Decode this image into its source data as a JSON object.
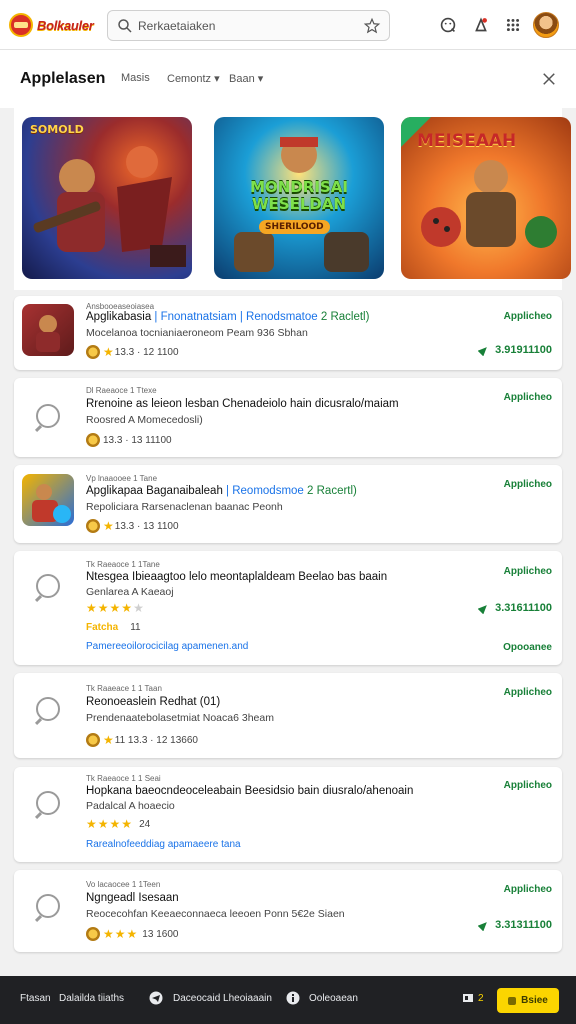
{
  "topbar": {
    "logo_text": "Bolkauler",
    "search_text": "Rerkaetaiaken",
    "icons": [
      "search-icon",
      "star-icon",
      "smiley-icon",
      "notification-icon",
      "apps-grid-icon",
      "avatar"
    ]
  },
  "header": {
    "title": "Applelasen",
    "filters": [
      "Masis",
      "Cemontz",
      "Baan"
    ]
  },
  "banners": [
    {
      "label": "SOMOLD",
      "colors": [
        "#2c3e91",
        "#e25822"
      ]
    },
    {
      "label": "MONDRISAI WESELDAN",
      "sublabel": "SHERILOOD",
      "colors": [
        "#1b9ed6",
        "#f5a623"
      ]
    },
    {
      "label": "MEISEAAH",
      "colors": [
        "#f39c12",
        "#e74c3c"
      ]
    }
  ],
  "cards": [
    {
      "meta": "Ansbooeaseoiasea",
      "title": "Apglikabasia",
      "title_blue": "| Fnonatnatsiam | Renodsmatoe",
      "title_green": "2 Racletl)",
      "sub": "Mocelanoa tocnianiaeroneom Peam 936 Sbhan",
      "rating": "13.3 · 12 1100",
      "badge": "Applicheo",
      "price": "3.91911100"
    },
    {
      "meta": "Dl Raeaoce 1 Ttexe",
      "title": "Rrenoine as leieon lesban Chenadeiolo hain dicusralo/maiam",
      "sub": "Roosred A Momecedosli)",
      "rating": "13.3 · 13 11100",
      "badge": "Applicheo"
    },
    {
      "meta": "Vp lnaaooee 1 Tane",
      "title": "Apglikapaa Baganaibaleah",
      "title_blue": "| Reomodsmoe",
      "title_green": "2 Racertl)",
      "sub": "Repoliciara Rarsenaclenan baanac Peonh",
      "rating": "13.3 · 13 1100",
      "badge": "Applicheo"
    },
    {
      "meta": "Tk Raeaoce 1 1Tane",
      "title": "Ntesgea Ibieaagtoo lelo meontaplaldeam Beelao bas baain",
      "sub": "Genlarea A Kaeaoj",
      "stars": 4,
      "rating_label": "Fatcha",
      "count": "11",
      "link": "Pamereeoilorocicilag apamenen.and",
      "badge": "Applicheo",
      "price": "3.31611100",
      "secondary": "Opooanee"
    },
    {
      "meta": "Tk Raaeace 1 1 Taan",
      "title": "Reonoeaslein Redhat (01)",
      "sub": "Prendenaatebolasetmiat Noaca6 3heam",
      "rating": "11 13.3 · 12 13660",
      "badge": "Applicheo"
    },
    {
      "meta": "Tk Raeaoce 1 1 Seai",
      "title": "Hopkana baeocndeoceleabain Beesidsio bain diusralo/ahenoain",
      "sub": "Padalcal A hoaecio",
      "stars": 4,
      "count": "24",
      "link": "Rarealnofeeddiag apamaeere tana",
      "badge": "Applicheo"
    },
    {
      "meta": "Vo lacaocee 1 1Teen",
      "title": "Ngngeadl Isesaan",
      "sub": "Reocecohfan Keeaeconnaeca leeoen Ponn 5€2e Siaen",
      "stars": 3,
      "count": "13 1600",
      "badge": "Applicheo",
      "price": "3.31311100"
    }
  ],
  "bottombar": {
    "left_label": "Ftasan",
    "left_value": "Dalailda tiiaths",
    "mid_label": "Daceocaid Lheoiaaain",
    "right_label": "Ooleoaean",
    "count": "2",
    "button_label": "Bsiee"
  },
  "colors": {
    "accent_green": "#188038",
    "link_blue": "#1a73e8",
    "button_yellow": "#fbd500",
    "star": "#f4b400"
  }
}
